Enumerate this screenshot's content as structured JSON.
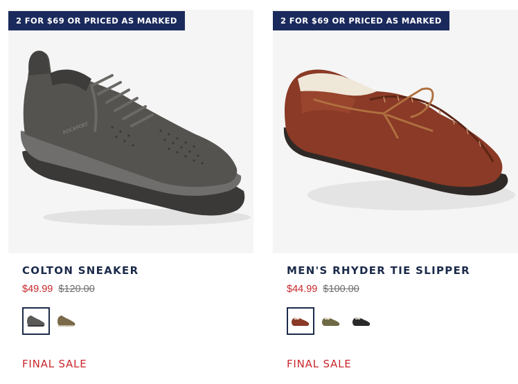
{
  "products": [
    {
      "promo_badge": "2 FOR $69 OR PRICED AS MARKED",
      "image": "gray-sneaker",
      "name": "COLTON SNEAKER",
      "sale_price": "$49.99",
      "original_price": "$120.00",
      "swatches": [
        {
          "color": "gray",
          "hex": "#5c5a57",
          "selected": true
        },
        {
          "color": "olive-tan",
          "hex": "#7a6a4a",
          "selected": false
        }
      ],
      "status": "FINAL SALE"
    },
    {
      "promo_badge": "2 FOR $69 OR PRICED AS MARKED",
      "image": "brown-moccasin-slipper",
      "name": "MEN'S RHYDER TIE SLIPPER",
      "sale_price": "$44.99",
      "original_price": "$100.00",
      "swatches": [
        {
          "color": "brown",
          "hex": "#8a3a26",
          "selected": true
        },
        {
          "color": "olive",
          "hex": "#6e6a45",
          "selected": false
        },
        {
          "color": "black",
          "hex": "#2a2a2a",
          "selected": false
        }
      ],
      "status": "FINAL SALE"
    }
  ],
  "colors": {
    "badge_bg": "#1b2a5c",
    "sale_red": "#c8262b",
    "navy_text": "#1b2a4a",
    "image_bg": "#f5f5f5"
  }
}
